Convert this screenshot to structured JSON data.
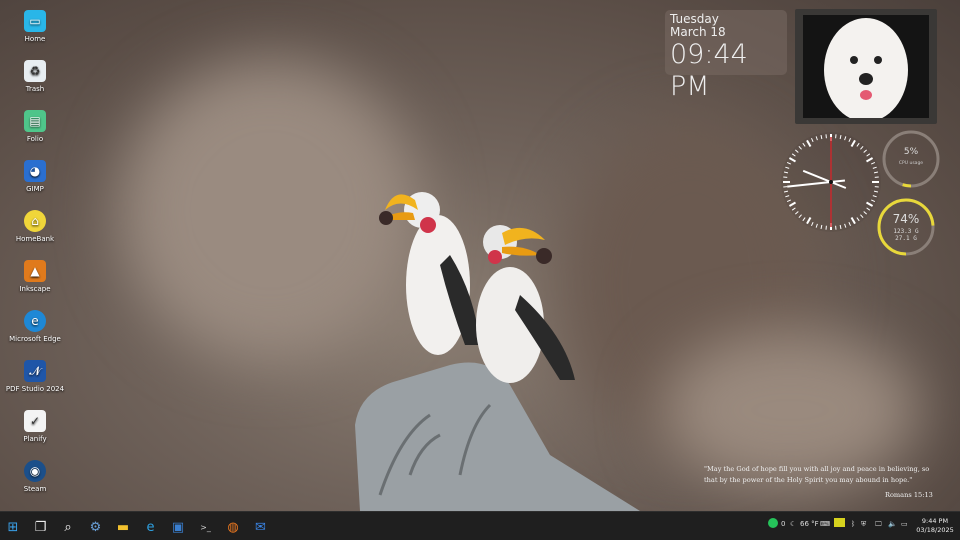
{
  "desktop_icons": [
    {
      "label": "Home",
      "icon": "monitor-icon",
      "color": "#29b6e8"
    },
    {
      "label": "Trash",
      "icon": "trash-icon",
      "color": "#e8eef2"
    },
    {
      "label": "Folio",
      "icon": "notebook-icon",
      "color": "#4fc58a"
    },
    {
      "label": "GIMP",
      "icon": "gimp-icon",
      "color": "#2a6fd0"
    },
    {
      "label": "HomeBank",
      "icon": "homebank-icon",
      "color": "#f0d63a"
    },
    {
      "label": "Inkscape",
      "icon": "inkscape-icon",
      "color": "#e07a1c"
    },
    {
      "label": "Microsoft Edge",
      "icon": "edge-icon",
      "color": "#1e88d6"
    },
    {
      "label": "PDF Studio 2024",
      "icon": "pdf-studio-icon",
      "color": "#1f56a8"
    },
    {
      "label": "Planify",
      "icon": "checklist-icon",
      "color": "#f4f4f4"
    },
    {
      "label": "Steam",
      "icon": "steam-icon",
      "color": "#1b4f8a"
    }
  ],
  "date_widget": {
    "day": "Tuesday",
    "date": "March 18",
    "time": "09:44 PM"
  },
  "cpu_widget": {
    "percent_label": "5%",
    "caption": "CPU usage",
    "fraction": 0.05,
    "color": "#e8d83a"
  },
  "disk_widget": {
    "percent_label": "74%",
    "line1": "123.3 G",
    "line2": "27.1 G",
    "fraction": 0.74,
    "color": "#e8d83a"
  },
  "analog_clock": {
    "hour": 9,
    "minute": 44,
    "second": 0
  },
  "quote": {
    "text": "\"May the God of hope fill you with all joy and peace in believing, so that by the power of the Holy Spirit you may abound in hope.\"",
    "reference": "Romans 15:13"
  },
  "taskbar": {
    "apps": [
      "start-icon",
      "task-view-icon",
      "search-icon",
      "settings-icon",
      "file-explorer-icon",
      "edge-icon",
      "store-icon",
      "terminal-icon",
      "firefox-icon",
      "mail-icon"
    ],
    "tray": {
      "whatsapp_count": "0",
      "weather": "66 °F",
      "time": "9:44 PM",
      "date": "03/18/2025"
    }
  }
}
